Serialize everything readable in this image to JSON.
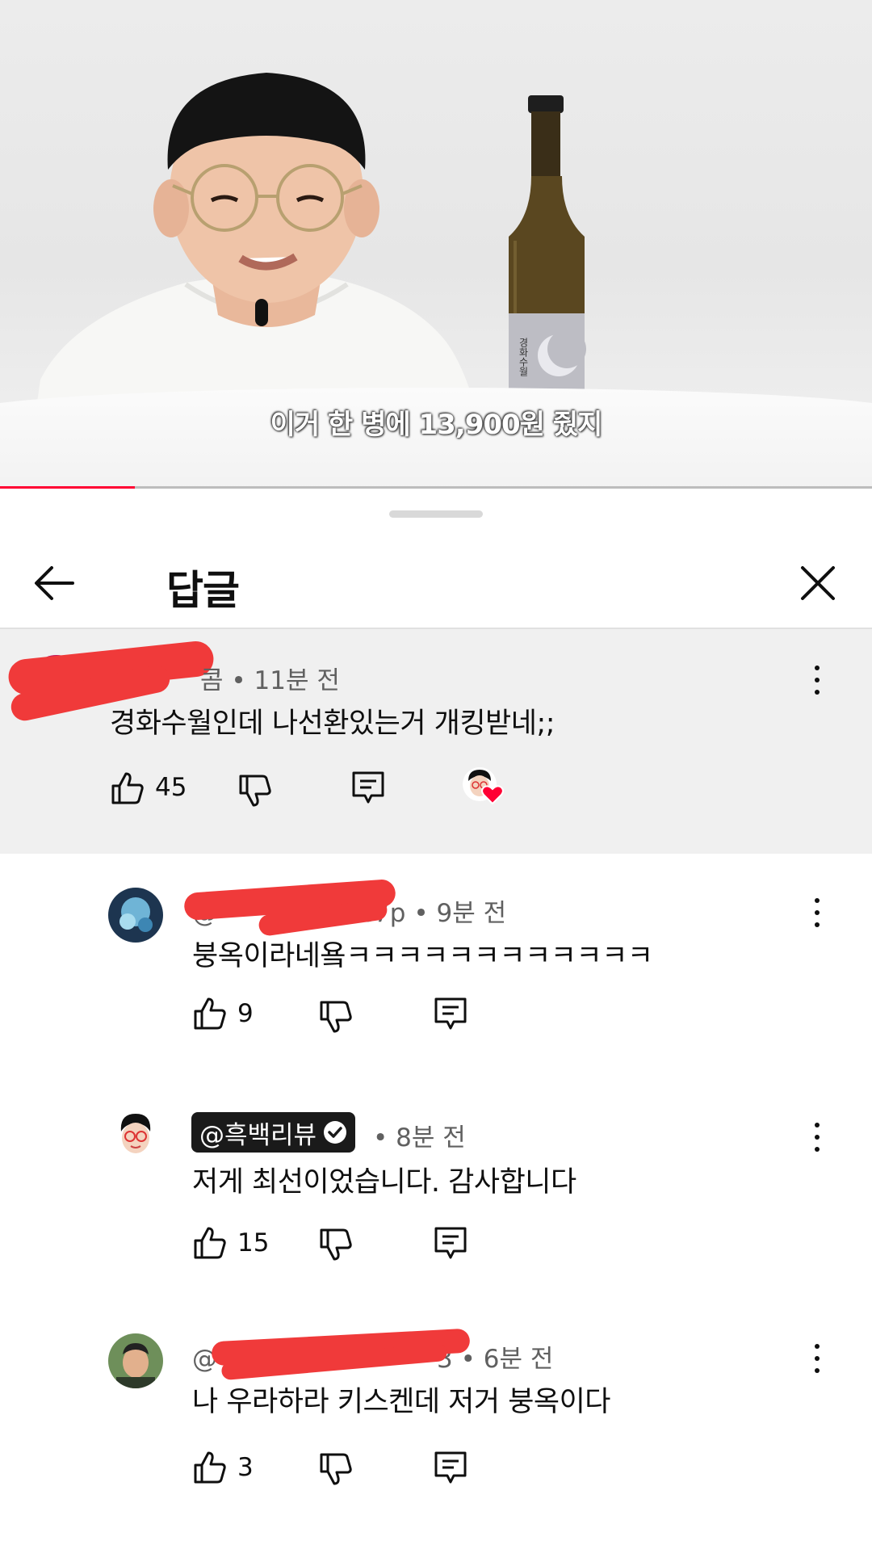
{
  "video": {
    "subtitle": "이거 한 병에 13,900원 줬지",
    "bottle_label": "경화수월",
    "progress_percent": 15.5
  },
  "sheet": {
    "title": "답글"
  },
  "parent_comment": {
    "author": "@",
    "author_tail": "콤",
    "time": "• 11분 전",
    "text": "경화수월인데 나선환있는거 개킹받네;;",
    "likes": "45",
    "creator_heart": true
  },
  "replies": [
    {
      "author_tail": "e7p",
      "author_prefix": "@",
      "time": "• 9분 전",
      "text": "붕옥이라네욬ㅋㅋㅋㅋㅋㅋㅋㅋㅋㅋㅋㅋ",
      "likes": "9"
    },
    {
      "author": "@흑백리뷰",
      "verified": true,
      "time": "• 8분 전",
      "text": "저게 최선이었습니다. 감사합니다",
      "likes": "15"
    },
    {
      "author_prefix": "@",
      "author_tail": "3",
      "time": "• 6분 전",
      "text": "나 우라하라 키스켄데 저거 붕옥이다",
      "likes": "3"
    }
  ],
  "colors": {
    "accent_red": "#ff0033",
    "redaction": "#f03a3a",
    "heart": "#ff0033",
    "parent_bg": "#f0f0f0"
  },
  "icons": [
    "back-arrow-icon",
    "close-icon",
    "like-icon",
    "dislike-icon",
    "reply-icon",
    "more-vert-icon",
    "heart-icon",
    "verified-icon"
  ]
}
